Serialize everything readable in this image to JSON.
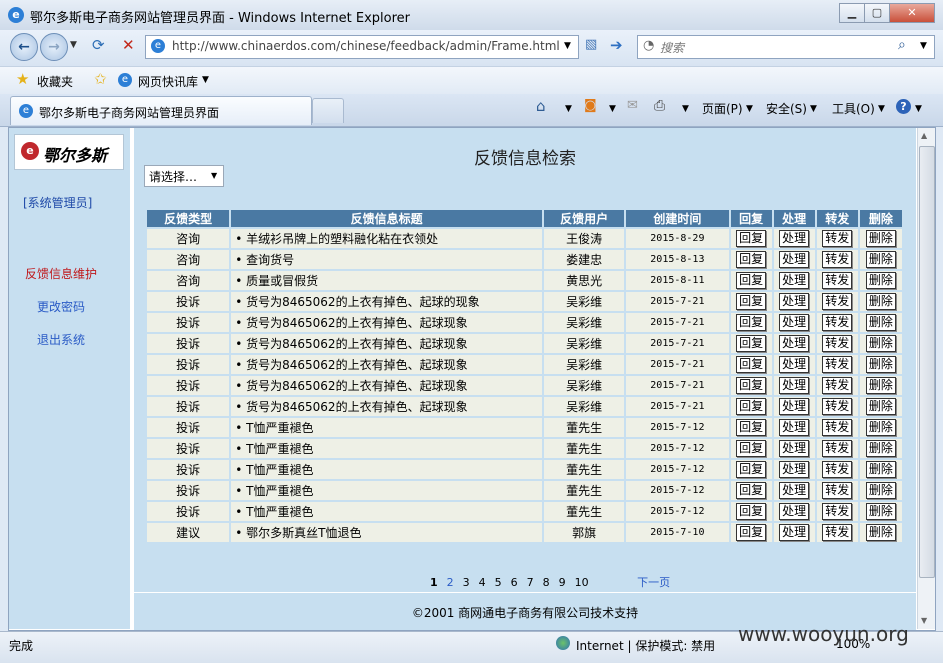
{
  "window": {
    "title": "鄂尔多斯电子商务网站管理员界面 - Windows Internet Explorer",
    "min": "▭",
    "max": "▢",
    "close": "✕"
  },
  "nav": {
    "url": "http://www.chinaerdos.com/chinese/feedback/admin/Frame.html",
    "search_placeholder": "搜索"
  },
  "favbar": {
    "favorites": "收藏夹",
    "quicklinks": "网页快讯库"
  },
  "tab": {
    "title": "鄂尔多斯电子商务网站管理员界面"
  },
  "cmdbar": {
    "page": "页面(P)",
    "safety": "安全(S)",
    "tools": "工具(O)"
  },
  "sidebar": {
    "admin": "[系统管理员]",
    "items": [
      "反馈信息维护",
      "更改密码",
      "退出系统"
    ],
    "logo_text": "鄂尔多斯"
  },
  "main": {
    "title": "反馈信息检索",
    "select_value": "请选择…",
    "columns": [
      "反馈类型",
      "反馈信息标题",
      "反馈用户",
      "创建时间",
      "回复",
      "处理",
      "转发",
      "删除"
    ],
    "actions": [
      "回复",
      "处理",
      "转发",
      "删除"
    ],
    "rows": [
      [
        "咨询",
        "羊绒衫吊牌上的塑料融化粘在衣领处",
        "王俊涛",
        "2015-8-29"
      ],
      [
        "咨询",
        "查询货号",
        "娄建忠",
        "2015-8-13"
      ],
      [
        "咨询",
        "质量或冒假货",
        "黄思光",
        "2015-8-11"
      ],
      [
        "投诉",
        "货号为8465062的上衣有掉色、起球的现象",
        "吴彩维",
        "2015-7-21"
      ],
      [
        "投诉",
        "货号为8465062的上衣有掉色、起球现象",
        "吴彩维",
        "2015-7-21"
      ],
      [
        "投诉",
        "货号为8465062的上衣有掉色、起球现象",
        "吴彩维",
        "2015-7-21"
      ],
      [
        "投诉",
        "货号为8465062的上衣有掉色、起球现象",
        "吴彩维",
        "2015-7-21"
      ],
      [
        "投诉",
        "货号为8465062的上衣有掉色、起球现象",
        "吴彩维",
        "2015-7-21"
      ],
      [
        "投诉",
        "货号为8465062的上衣有掉色、起球现象",
        "吴彩维",
        "2015-7-21"
      ],
      [
        "投诉",
        "T恤严重褪色",
        "董先生",
        "2015-7-12"
      ],
      [
        "投诉",
        "T恤严重褪色",
        "董先生",
        "2015-7-12"
      ],
      [
        "投诉",
        "T恤严重褪色",
        "董先生",
        "2015-7-12"
      ],
      [
        "投诉",
        "T恤严重褪色",
        "董先生",
        "2015-7-12"
      ],
      [
        "投诉",
        "T恤严重褪色",
        "董先生",
        "2015-7-12"
      ],
      [
        "建议",
        "鄂尔多斯真丝T恤退色",
        "郭旗",
        "2015-7-10"
      ]
    ],
    "pager": {
      "pages": [
        "1",
        "2",
        "3",
        "4",
        "5",
        "6",
        "7",
        "8",
        "9",
        "10"
      ],
      "current": "1",
      "next": "下一页"
    },
    "footer": "©2001 商网通电子商务有限公司技术支持"
  },
  "status": {
    "text": "完成",
    "zone": "Internet | 保护模式: 禁用",
    "zoom": "100%",
    "watermark": "www.wooyun.org"
  }
}
